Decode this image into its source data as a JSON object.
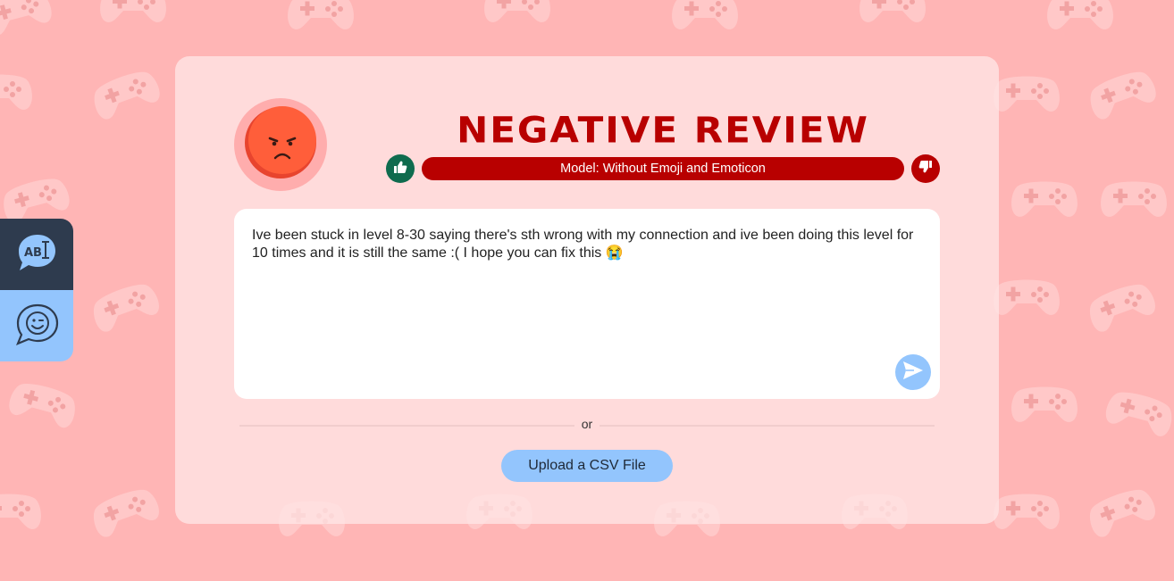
{
  "theme": {
    "background": "#ffb5b5",
    "accent_negative": "#b80000",
    "accent_positive": "#0f6b4e",
    "rail_dark": "#2e3b4e",
    "rail_light": "#93c5fd"
  },
  "side_rail": {
    "items": [
      {
        "icon": "text-bubble-icon",
        "active": true
      },
      {
        "icon": "emoji-bubble-icon",
        "active": false
      }
    ]
  },
  "result": {
    "face_icon": "angry-face-icon",
    "title": "Negative Review",
    "model_label": "Model: Without Emoji and Emoticon",
    "thumb_up_icon": "thumbs-up-icon",
    "thumb_down_icon": "thumbs-down-icon"
  },
  "review": {
    "text": "Ive been stuck in level 8-30 saying there's sth wrong with my connection and ive been doing this level for 10 times and it is still the same :( I hope you can fix this 😭",
    "send_icon": "send-icon"
  },
  "divider": {
    "label": "or"
  },
  "upload": {
    "label": "Upload a CSV File"
  }
}
